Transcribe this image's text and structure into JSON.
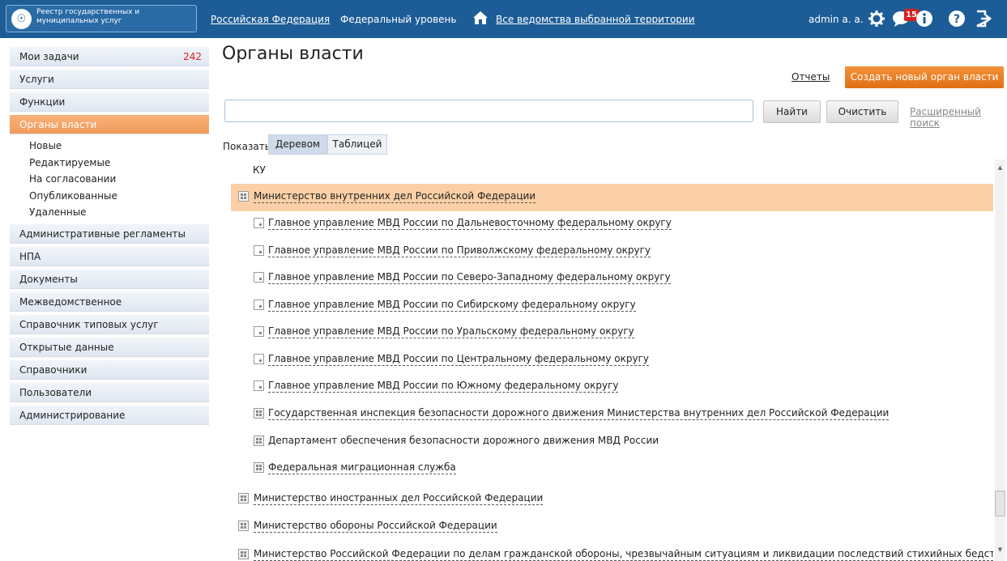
{
  "header": {
    "logo_text": "Реестр государственных и муниципальных услуг",
    "territory": "Российская Федерация",
    "level": "Федеральный уровень",
    "departments": "Все ведомства выбранной территории",
    "user": "admin a. a.",
    "notifications_count": "15"
  },
  "sidebar": {
    "items": [
      {
        "label": "Мои задачи",
        "count": "242"
      },
      {
        "label": "Услуги"
      },
      {
        "label": "Функции"
      },
      {
        "label": "Органы власти"
      },
      {
        "label": "Административные регламенты"
      },
      {
        "label": "НПА"
      },
      {
        "label": "Документы"
      },
      {
        "label": "Межведомственное взаимодействие"
      },
      {
        "label": "Справочник типовых услуг"
      },
      {
        "label": "Открытые данные"
      },
      {
        "label": "Справочники"
      },
      {
        "label": "Пользователи"
      },
      {
        "label": "Администрирование"
      }
    ],
    "subitems": [
      "Новые",
      "Редактируемые",
      "На согласовании",
      "Опубликованные",
      "Удаленные"
    ]
  },
  "main": {
    "title": "Органы власти",
    "reports_label": "Отчеты",
    "create_label": "Создать новый орган власти",
    "search_value": "",
    "find_label": "Найти",
    "clear_label": "Очистить",
    "advanced_label": "Расширенный поиск",
    "show_label": "Показать",
    "tabs": [
      "Деревом",
      "Таблицей"
    ],
    "active_tab": "Деревом"
  },
  "tree": {
    "rows": [
      {
        "text": "КУ",
        "level": 1,
        "icon": "none"
      },
      {
        "text": "Министерство внутренних дел Российской Федерации",
        "level": 0,
        "icon": "tree-icon",
        "selected": true
      },
      {
        "text": "Главное управление МВД России по Дальневосточному федеральному округу",
        "level": 1,
        "icon": "leaf-icon"
      },
      {
        "text": "Главное управление МВД России по Приволжскому федеральному округу",
        "level": 1,
        "icon": "leaf-icon"
      },
      {
        "text": "Главное управление МВД России по Северо-Западному федеральному округу",
        "level": 1,
        "icon": "leaf-icon"
      },
      {
        "text": "Главное управление МВД России по Сибирскому федеральному округу",
        "level": 1,
        "icon": "leaf-icon"
      },
      {
        "text": "Главное управление МВД России по Уральскому федеральному округу",
        "level": 1,
        "icon": "leaf-icon"
      },
      {
        "text": "Главное управление МВД России по Центральному федеральному округу",
        "level": 1,
        "icon": "leaf-icon"
      },
      {
        "text": "Главное управление МВД России по Южному федеральному округу",
        "level": 1,
        "icon": "leaf-icon"
      },
      {
        "text": "Государственная инспекция безопасности дорожного движения Министерства внутренних дел Российской Федерации",
        "level": 1,
        "icon": "tree-icon"
      },
      {
        "text": "Департамент обеспечения безопасности дорожного движения МВД России",
        "level": 1,
        "icon": "tree-icon"
      },
      {
        "text": "Федеральная миграционная служба",
        "level": 1,
        "icon": "tree-icon"
      },
      {
        "text": "Министерство иностранных дел Российской Федерации",
        "level": 0,
        "icon": "tree-icon"
      },
      {
        "text": "Министерство обороны Российской Федерации",
        "level": 0,
        "icon": "tree-icon"
      },
      {
        "text": "Министерство Российской Федерации по делам гражданской обороны, чрезвычайным ситуациям и ликвидации последствий стихийных бедствий",
        "level": 0,
        "icon": "tree-icon"
      }
    ]
  },
  "colors": {
    "header_bg": "#1d5d97",
    "accent_orange": "#e87f23",
    "selected_row": "#fcd0a6",
    "count_red": "#d62020"
  }
}
